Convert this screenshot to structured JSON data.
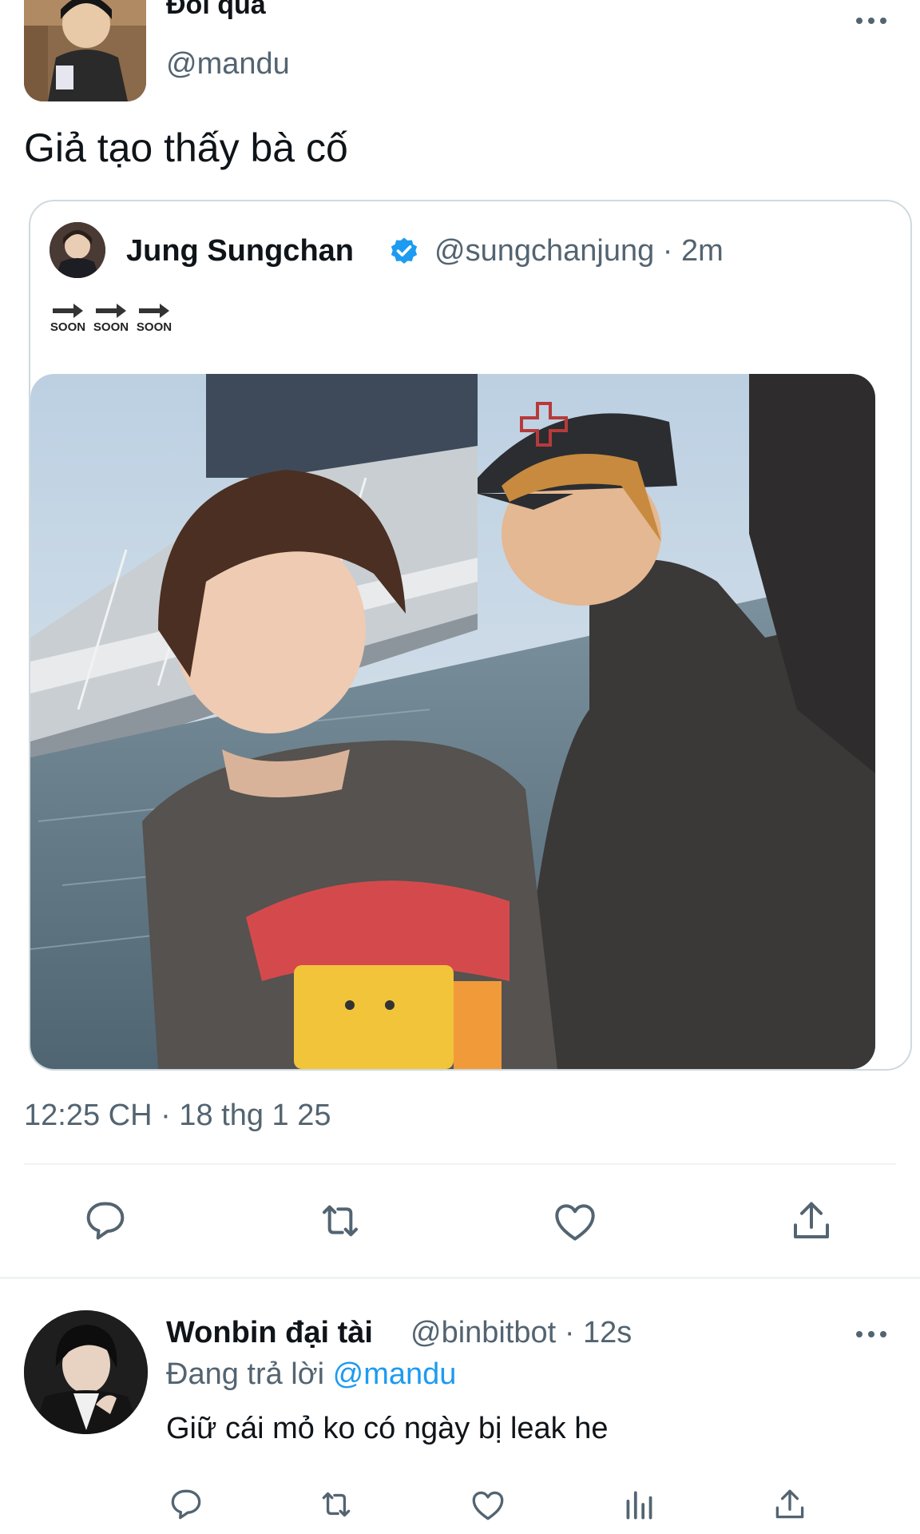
{
  "tweet": {
    "display_name": "Đoi qua",
    "handle": "@mandu",
    "text": "Giả tạo thấy bà cố",
    "timestamp": "12:25 CH · 18 thg 1 25"
  },
  "quoted": {
    "display_name": "Jung Sungchan",
    "handle": "@sungchanjung",
    "separator": "·",
    "time": "2m",
    "emojis": [
      "SOON",
      "SOON",
      "SOON"
    ],
    "verified_color": "#1d9bf0"
  },
  "reply": {
    "display_name": "Wonbin đại tài",
    "handle": "@binbitbot",
    "separator": "·",
    "time": "12s",
    "replying_prefix": "Đang trả lời",
    "replying_to": "@mandu",
    "text": "Giữ cái mỏ ko có ngày bị leak he"
  },
  "icons": {
    "main_actions": [
      "reply-icon",
      "retweet-icon",
      "like-icon",
      "share-icon"
    ],
    "reply_actions": [
      "reply-icon",
      "retweet-icon",
      "like-icon",
      "views-icon",
      "share-icon"
    ]
  },
  "colors": {
    "accent": "#1d9bf0",
    "secondary_text": "#536471",
    "divider": "#eff3f4"
  }
}
